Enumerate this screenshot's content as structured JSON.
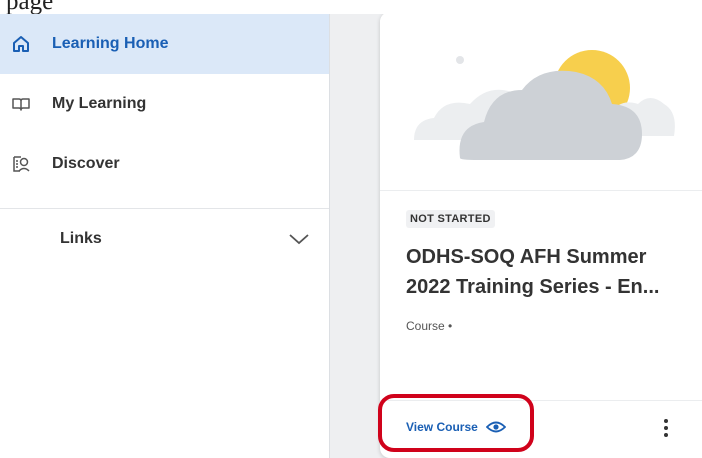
{
  "sidebar": {
    "items": [
      {
        "label": "Learning Home",
        "icon": "home-icon",
        "active": true
      },
      {
        "label": "My Learning",
        "icon": "book-icon",
        "active": false
      },
      {
        "label": "Discover",
        "icon": "discover-icon",
        "active": false
      }
    ],
    "links": {
      "label": "Links",
      "icon": "chevron-down-icon"
    }
  },
  "card": {
    "image_icon": "cloud-sun-illustration",
    "status": "NOT STARTED",
    "title_line1": "ODHS-SOQ AFH Summer",
    "title_line2": "2022 Training Series - En...",
    "type": "Course •",
    "action_label": "View Course",
    "action_icon": "eye-icon",
    "menu_icon": "more-vertical-icon"
  },
  "colors": {
    "accent": "#1a5fb4",
    "active_bg": "#dbe8f8",
    "highlight": "#d0021b",
    "sun": "#f7cf4d",
    "cloud": "#cdd1d6"
  }
}
